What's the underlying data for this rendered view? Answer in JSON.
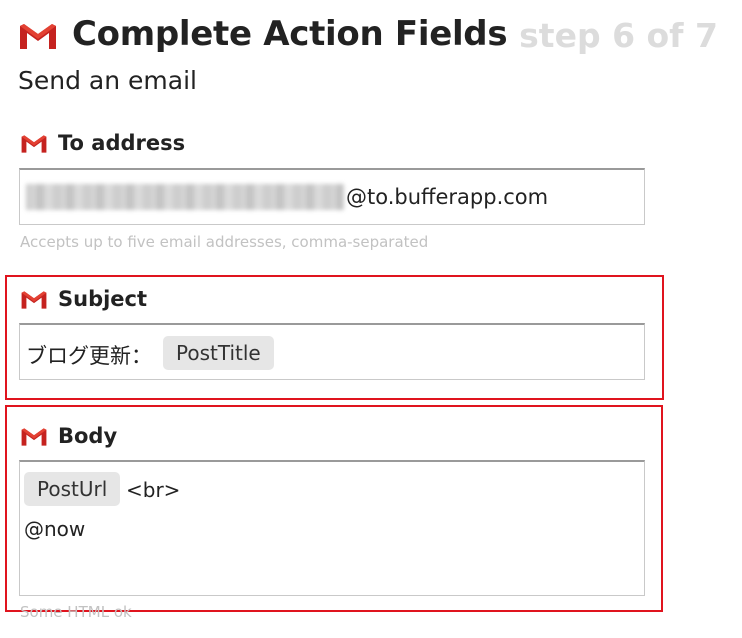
{
  "header": {
    "title": "Complete Action Fields",
    "step": "step 6 of 7",
    "icon": "gmail-icon"
  },
  "subtitle": "Send an email",
  "fields": {
    "to_address": {
      "label": "To address",
      "value_visible": "@to.bufferapp.com",
      "helper": "Accepts up to five email addresses, comma-separated"
    },
    "subject": {
      "label": "Subject",
      "prefix": "ブログ更新：",
      "ingredient": "PostTitle"
    },
    "body": {
      "label": "Body",
      "ingredient": "PostUrl",
      "line1_text": "<br>",
      "line2_text": "@now",
      "helper": "Some HTML ok"
    }
  },
  "colors": {
    "highlight": "#e0141e",
    "gmail_red": "#c5221f",
    "step_gray": "#dcdcdc",
    "pill_bg": "#e6e6e6"
  }
}
